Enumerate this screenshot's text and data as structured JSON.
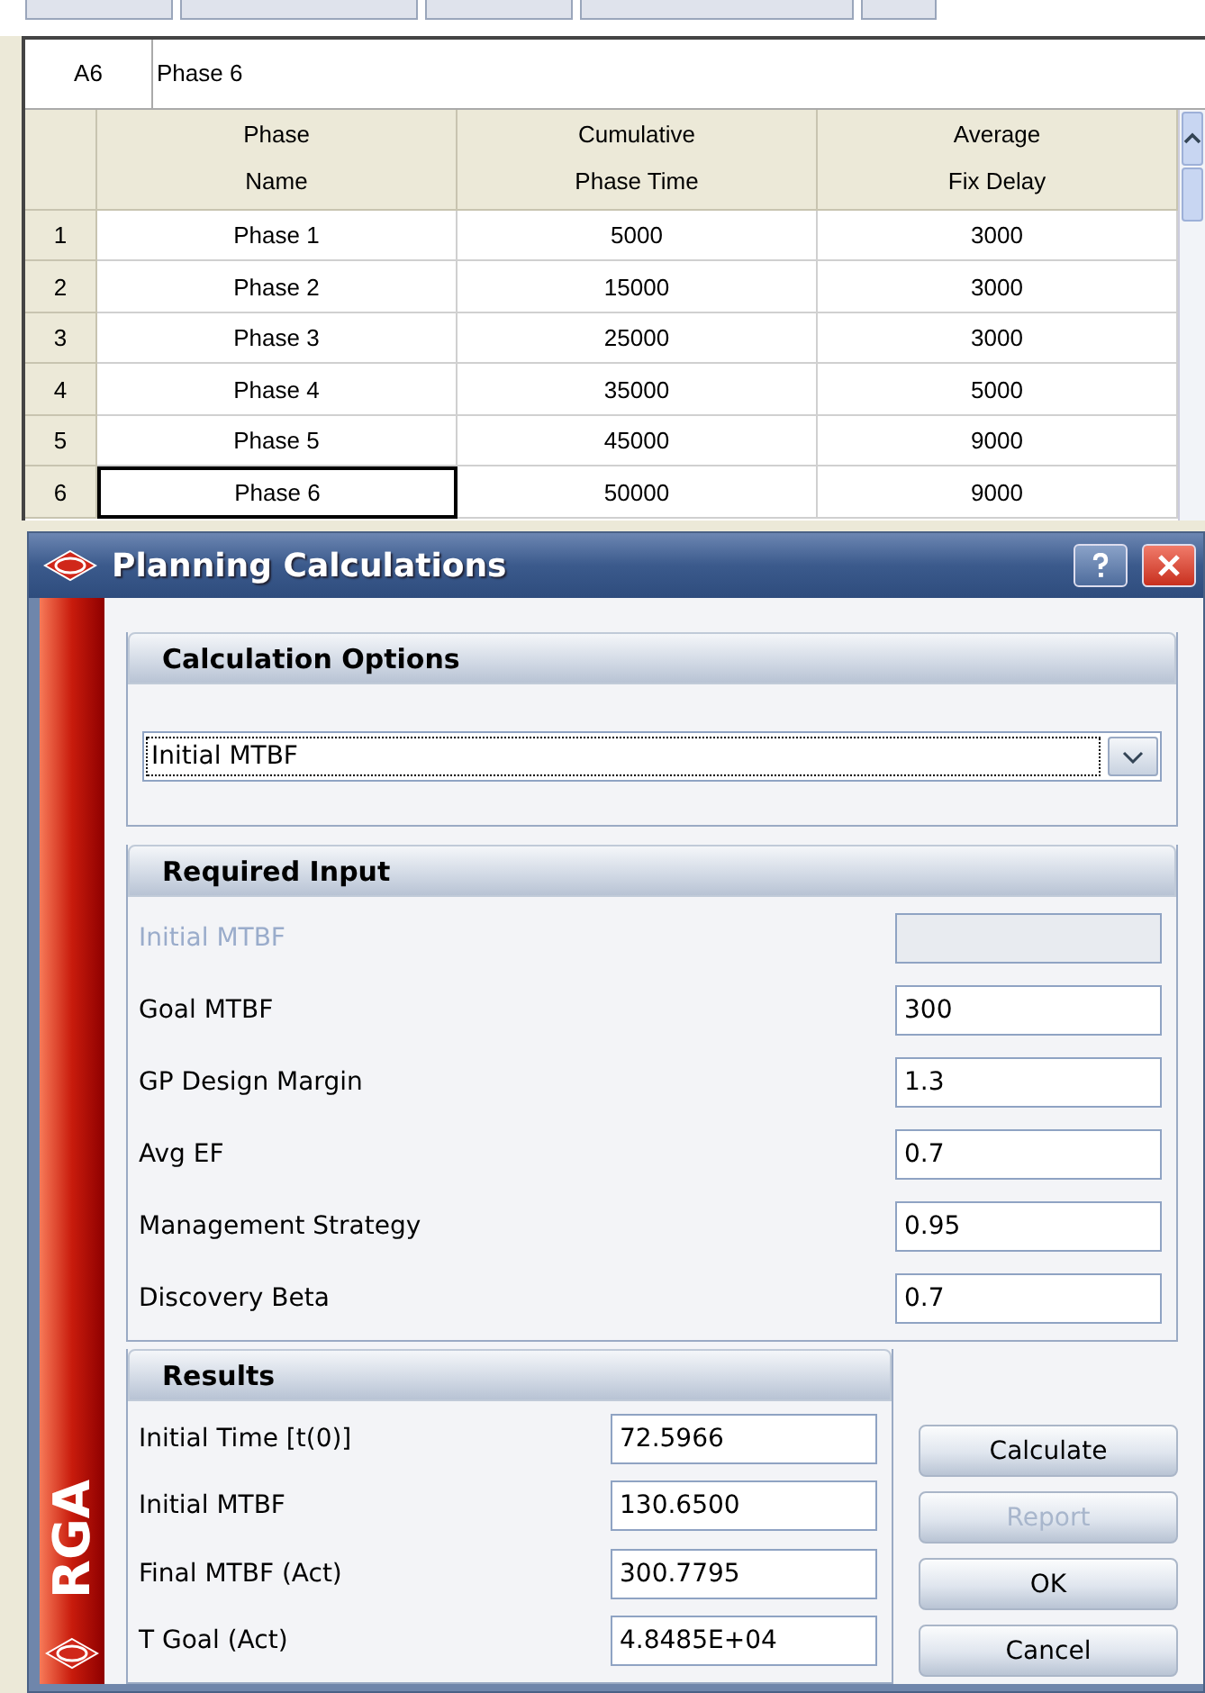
{
  "spreadsheet": {
    "cell_ref": "A6",
    "cell_value": "Phase 6",
    "columns": [
      "Phase\nName",
      "Cumulative\nPhase Time",
      "Average\nFix Delay"
    ],
    "rows": [
      {
        "number": "1",
        "cells": [
          "Phase 1",
          "5000",
          "3000"
        ],
        "selected": false
      },
      {
        "number": "2",
        "cells": [
          "Phase 2",
          "15000",
          "3000"
        ],
        "selected": false
      },
      {
        "number": "3",
        "cells": [
          "Phase 3",
          "25000",
          "3000"
        ],
        "selected": false
      },
      {
        "number": "4",
        "cells": [
          "Phase 4",
          "35000",
          "5000"
        ],
        "selected": false
      },
      {
        "number": "5",
        "cells": [
          "Phase 5",
          "45000",
          "9000"
        ],
        "selected": false
      },
      {
        "number": "6",
        "cells": [
          "Phase 6",
          "50000",
          "9000"
        ],
        "selected": true
      }
    ]
  },
  "dialog": {
    "title": "Planning Calculations",
    "sidebar_text": "RGA",
    "calculation_options": {
      "title": "Calculation Options",
      "value": "Initial MTBF"
    },
    "required_input": {
      "title": "Required Input",
      "fields": [
        {
          "label": "Initial MTBF",
          "disabled": true
        },
        {
          "label": "Goal MTBF",
          "value": "300",
          "disabled": false
        },
        {
          "label": "GP Design Margin",
          "value": "1.3",
          "disabled": false
        },
        {
          "label": "Avg EF",
          "value": "0.7",
          "disabled": false
        },
        {
          "label": "Management Strategy",
          "value": "0.95",
          "disabled": false
        },
        {
          "label": "Discovery Beta",
          "value": "0.7",
          "disabled": false
        }
      ]
    },
    "results": {
      "title": "Results",
      "fields": [
        {
          "label": "Initial Time [t(0)]",
          "value": "72.5966"
        },
        {
          "label": "Initial MTBF",
          "value": "130.6500"
        },
        {
          "label": "Final MTBF (Act)",
          "value": "300.7795"
        },
        {
          "label": "T Goal (Act)",
          "value": "4.8485E+04"
        }
      ]
    },
    "buttons": [
      {
        "label": "Calculate",
        "disabled": false
      },
      {
        "label": "Report",
        "disabled": true
      },
      {
        "label": "OK",
        "disabled": false
      },
      {
        "label": "Cancel",
        "disabled": false
      }
    ]
  }
}
